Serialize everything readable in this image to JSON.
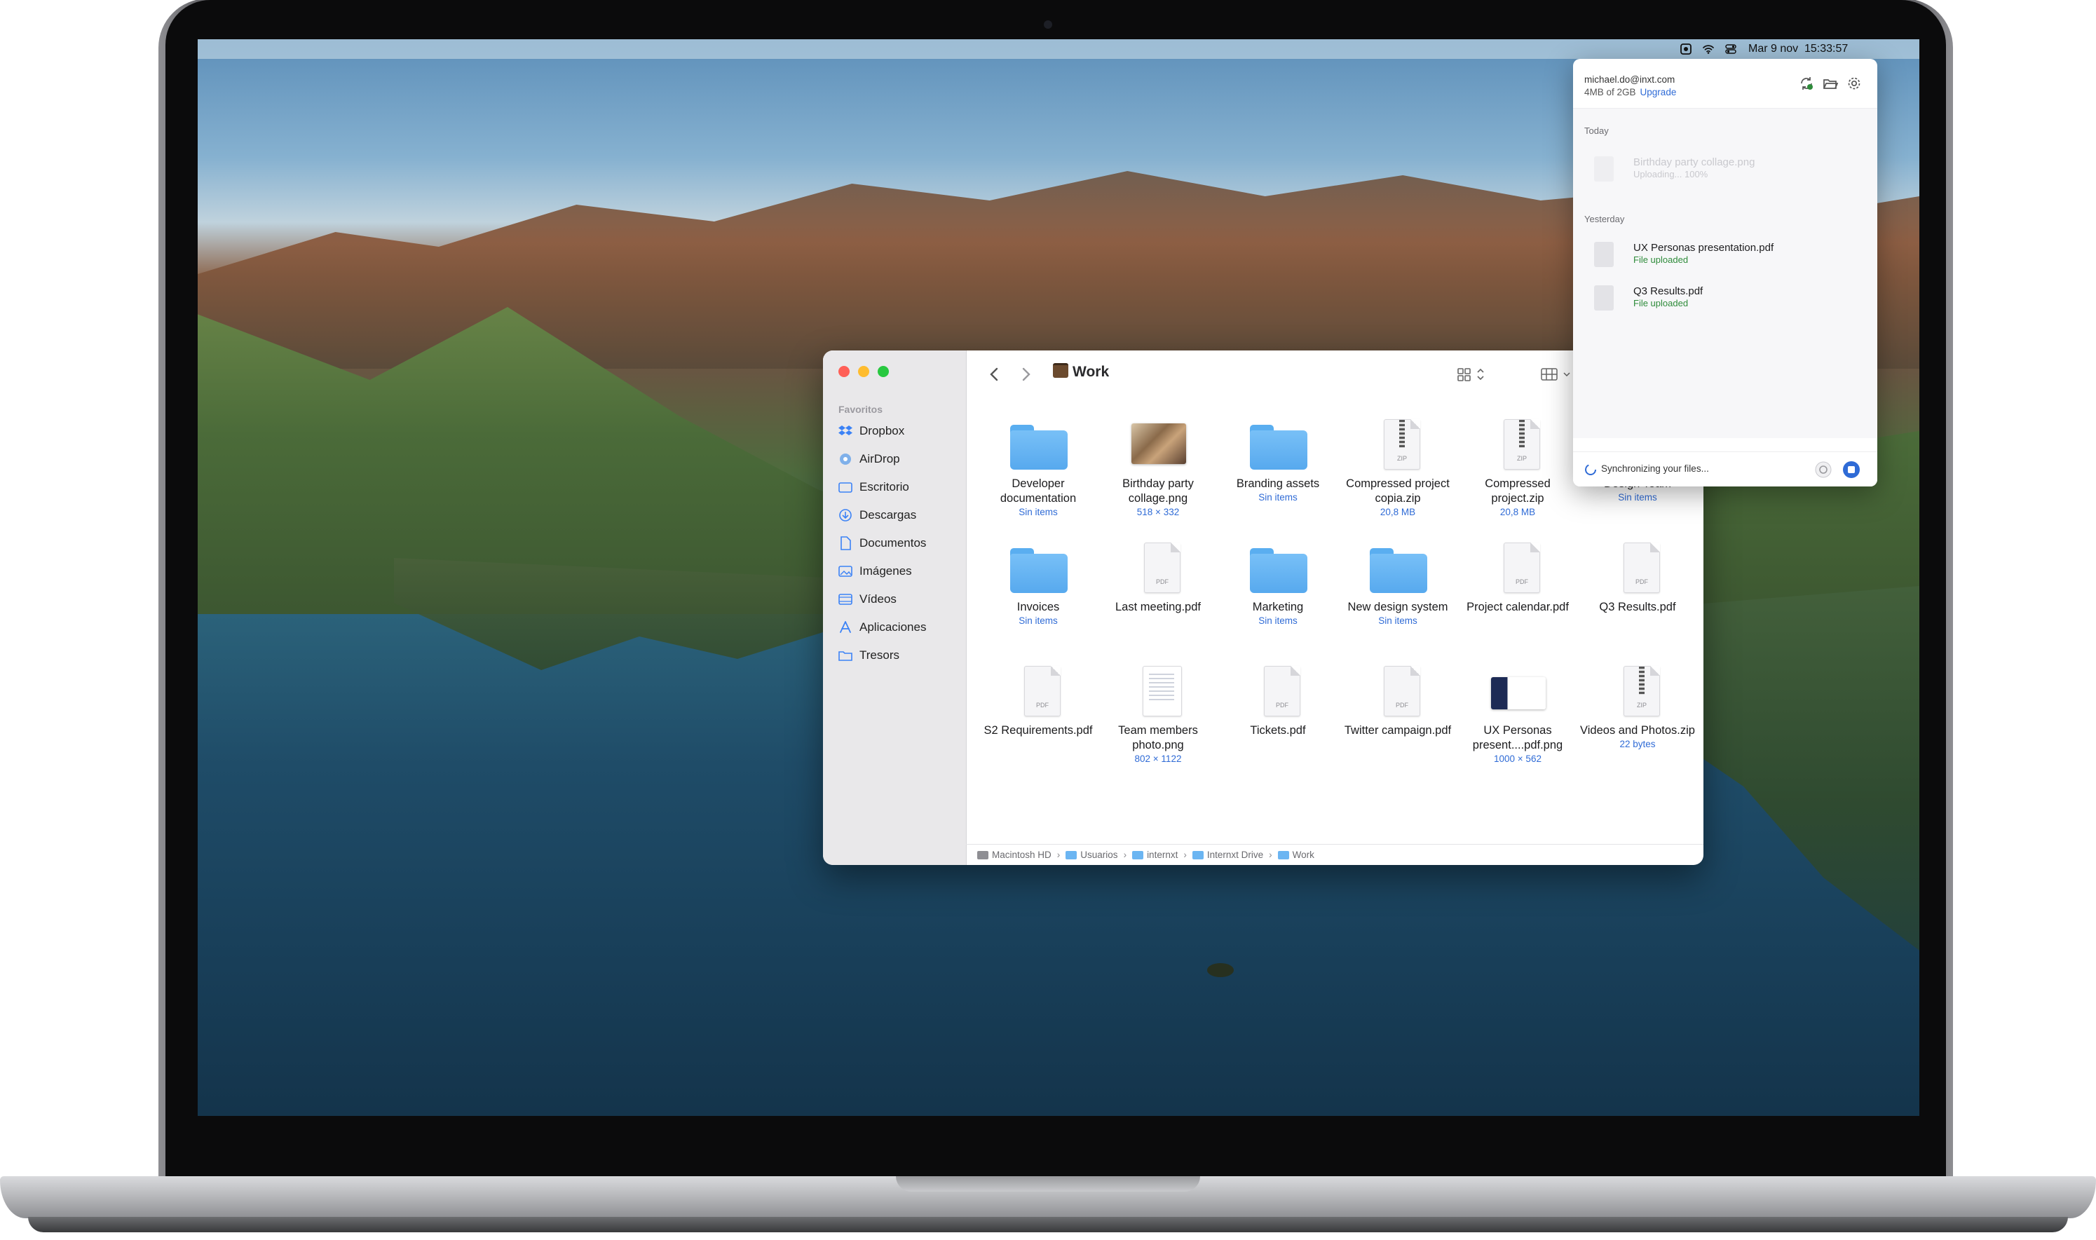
{
  "menubar": {
    "date": "Mar 9 nov",
    "time": "15:33:57"
  },
  "finder": {
    "title": "Work",
    "sidebar_header": "Favoritos",
    "sidebar": [
      {
        "label": "Dropbox",
        "icon": "dropbox-icon"
      },
      {
        "label": "AirDrop",
        "icon": "airdrop-icon"
      },
      {
        "label": "Escritorio",
        "icon": "desktop-folder-icon"
      },
      {
        "label": "Descargas",
        "icon": "downloads-icon"
      },
      {
        "label": "Documentos",
        "icon": "documents-icon"
      },
      {
        "label": "Imágenes",
        "icon": "pictures-icon"
      },
      {
        "label": "Vídeos",
        "icon": "movies-icon"
      },
      {
        "label": "Aplicaciones",
        "icon": "applications-icon"
      },
      {
        "label": "Tresors",
        "icon": "folder-icon"
      }
    ],
    "items": [
      {
        "name": "Developer documentation",
        "sub": "Sin items",
        "kind": "folder"
      },
      {
        "name": "Birthday party collage.png",
        "sub": "518 × 332",
        "kind": "photo"
      },
      {
        "name": "Branding assets",
        "sub": "Sin items",
        "kind": "folder"
      },
      {
        "name": "Compressed project copia.zip",
        "sub": "20,8 MB",
        "kind": "zip"
      },
      {
        "name": "Compressed project.zip",
        "sub": "20,8 MB",
        "kind": "zip"
      },
      {
        "name": "Design Team",
        "sub": "Sin items",
        "kind": "folder"
      },
      {
        "name": "Invoices",
        "sub": "Sin items",
        "kind": "folder"
      },
      {
        "name": "Last meeting.pdf",
        "sub": "",
        "kind": "pdf"
      },
      {
        "name": "Marketing",
        "sub": "Sin items",
        "kind": "folder"
      },
      {
        "name": "New design system",
        "sub": "Sin items",
        "kind": "folder"
      },
      {
        "name": "Project calendar.pdf",
        "sub": "",
        "kind": "pdf"
      },
      {
        "name": "Q3 Results.pdf",
        "sub": "",
        "kind": "pdf"
      },
      {
        "name": "S2 Requirements.pdf",
        "sub": "",
        "kind": "pdf"
      },
      {
        "name": "Team members photo.png",
        "sub": "802 × 1122",
        "kind": "page"
      },
      {
        "name": "Tickets.pdf",
        "sub": "",
        "kind": "pdf"
      },
      {
        "name": "Twitter campaign.pdf",
        "sub": "",
        "kind": "pdf"
      },
      {
        "name": "UX Personas present....pdf.png",
        "sub": "1000 × 562",
        "kind": "slide"
      },
      {
        "name": "Videos and Photos.zip",
        "sub": "22 bytes",
        "kind": "zip"
      }
    ],
    "pathbar": [
      "Macintosh HD",
      "Usuarios",
      "internxt",
      "Internxt Drive",
      "Work"
    ],
    "file_type_labels": {
      "zip": "ZIP",
      "pdf": "PDF"
    }
  },
  "popup": {
    "email": "michael.do@inxt.com",
    "usage": "4MB of 2GB",
    "upgrade": "Upgrade",
    "section_today": "Today",
    "section_yesterday": "Yesterday",
    "today_items": [
      {
        "name": "Birthday party collage.png",
        "status": "Uploading... 100%"
      }
    ],
    "yesterday_items": [
      {
        "name": "UX Personas presentation.pdf",
        "status": "File uploaded"
      },
      {
        "name": "Q3 Results.pdf",
        "status": "File uploaded"
      }
    ],
    "sync_status": "Synchronizing your files..."
  },
  "colors": {
    "accent": "#2f6bd6",
    "folder": "#5aaef0",
    "success": "#2e8b3a",
    "close": "#ff5f57",
    "minimize": "#febc2e",
    "zoom": "#28c840"
  }
}
